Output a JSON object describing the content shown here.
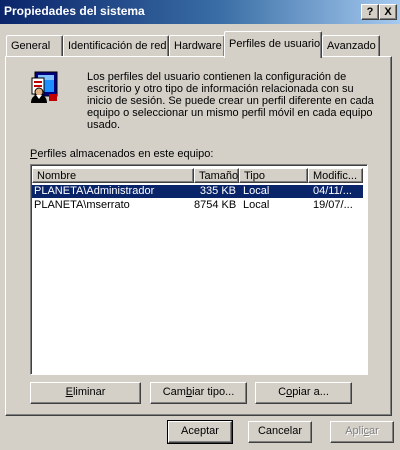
{
  "window": {
    "title": "Propiedades del sistema",
    "help_label": "?",
    "close_label": "X"
  },
  "tabs": [
    {
      "label": "General",
      "active": false
    },
    {
      "label": "Identificación de red",
      "active": false
    },
    {
      "label": "Hardware",
      "active": false
    },
    {
      "label": "Perfiles de usuario",
      "active": true
    },
    {
      "label": "Avanzado",
      "active": false
    }
  ],
  "panel": {
    "icon": "user-profiles-icon",
    "description": "Los perfiles del usuario contienen la configuración de escritorio y otro tipo de información relacionada con su inicio de sesión. Se puede crear un perfil diferente en cada equipo o seleccionar un mismo perfil móvil en cada equipo usado.",
    "profiles_label": {
      "mnemonic": "P",
      "rest": "erfiles almacenados en este equipo:"
    }
  },
  "profiles_table": {
    "columns": [
      "Nombre",
      "Tamaño",
      "Tipo",
      "Modific..."
    ],
    "rows": [
      {
        "name": "PLANETA\\Administrador",
        "size": "335 KB",
        "type": "Local",
        "modified": "04/11/...",
        "selected": true
      },
      {
        "name": "PLANETA\\mserrato",
        "size": "8754 KB",
        "type": "Local",
        "modified": "19/07/...",
        "selected": false
      }
    ]
  },
  "profile_buttons": {
    "delete": {
      "mnemonic": "E",
      "rest": "liminar"
    },
    "change_type": {
      "before": "Cam",
      "mnemonic": "b",
      "rest": "iar tipo..."
    },
    "copy_to": {
      "before": "C",
      "mnemonic": "o",
      "rest": "piar a..."
    }
  },
  "dialog_buttons": {
    "ok": "Aceptar",
    "cancel": "Cancelar",
    "apply": {
      "before": "Apli",
      "mnemonic": "c",
      "rest": "ar",
      "enabled": false
    }
  },
  "colors": {
    "selection": "#0a246a",
    "titlebar_start": "#0a246a",
    "face": "#d4d0c8"
  }
}
